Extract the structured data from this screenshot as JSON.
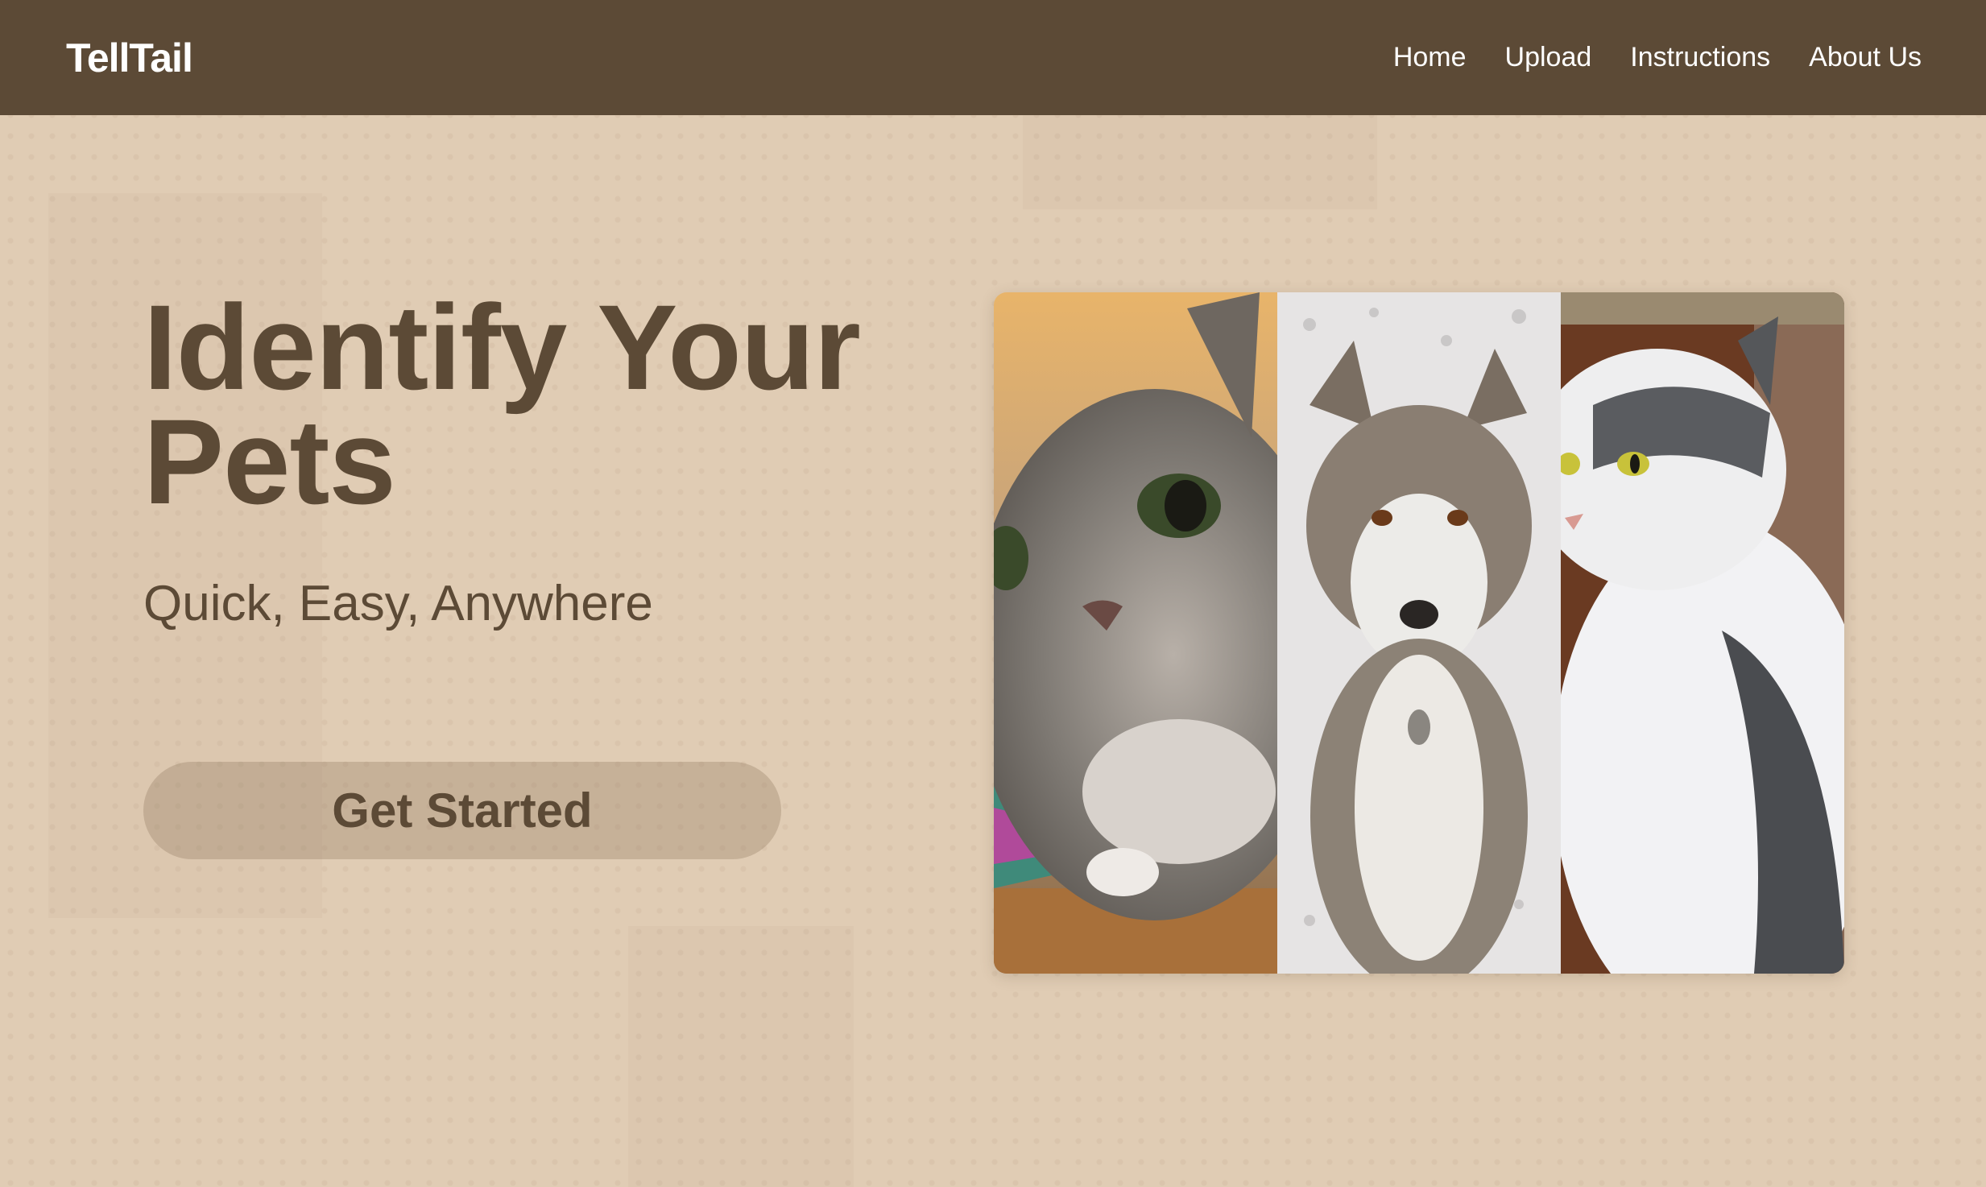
{
  "nav": {
    "logo": "TellTail",
    "links": [
      "Home",
      "Upload",
      "Instructions",
      "About Us"
    ]
  },
  "hero": {
    "title_line1": "Identify Your",
    "title_line2": "Pets",
    "subtitle": "Quick, Easy, Anywhere",
    "cta_label": "Get Started"
  },
  "gallery": {
    "photos": [
      {
        "subject": "gray tabby cat close-up"
      },
      {
        "subject": "husky dog in snow"
      },
      {
        "subject": "white and gray fluffy cat"
      }
    ]
  },
  "colors": {
    "navbar": "#5c4a36",
    "background": "#e0ccb4",
    "text": "#5c4a36",
    "button": "#c7b29a"
  }
}
